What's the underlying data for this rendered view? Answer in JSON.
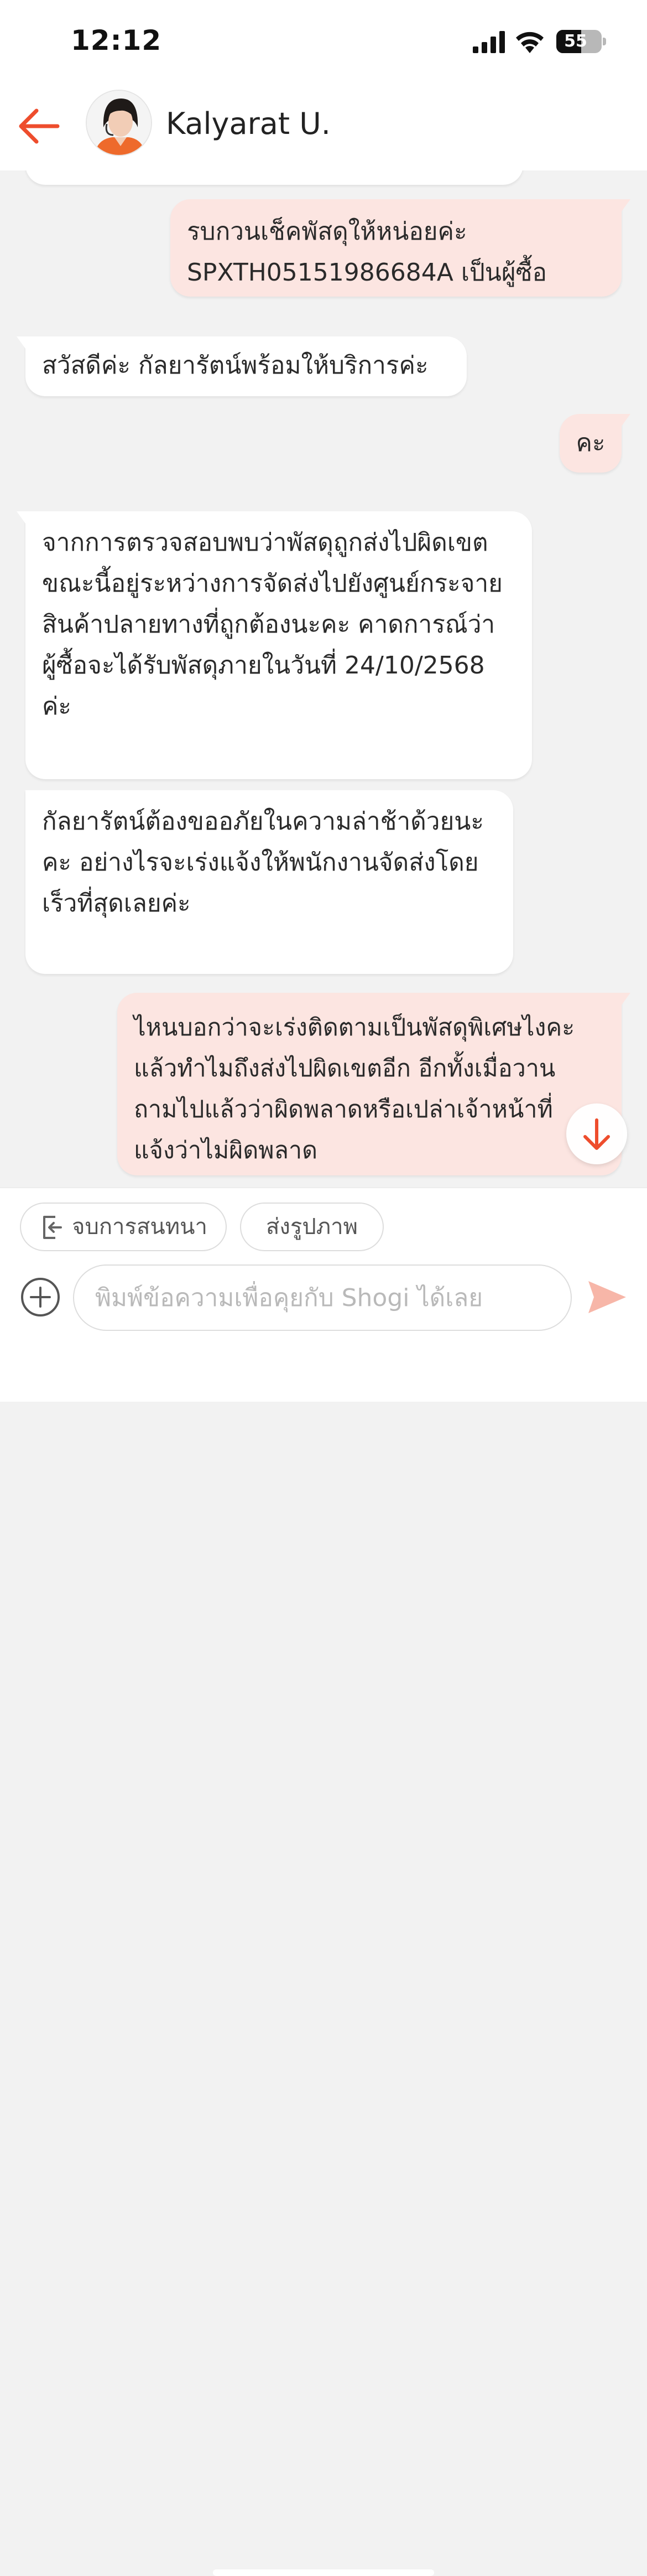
{
  "status_bar": {
    "time": "12:12",
    "battery_label": "55",
    "battery_level_percent": 55
  },
  "header": {
    "contact_name": "Kalyarat U.",
    "back_icon": "arrow-left-icon",
    "accent_color": "#ee4d2d"
  },
  "messages": [
    {
      "direction": "outgoing",
      "text": "รบกวนเช็คพัสดุให้หน่อยค่ะ\nSPXTH05151986684A    เป็นผู้ซื้อ"
    },
    {
      "direction": "incoming",
      "text": "สวัสดีค่ะ กัลยารัตน์พร้อมให้บริการค่ะ"
    },
    {
      "direction": "outgoing",
      "text": "คะ"
    },
    {
      "direction": "incoming",
      "text": "จากการตรวจสอบพบว่าพัสดุถูกส่งไปผิดเขต\nขณะนี้อยู่ระหว่างการจัดส่งไปยังศูนย์กระจาย\nสินค้าปลายทางที่ถูกต้องนะคะ คาดการณ์ว่า\nผู้ซื้อจะได้รับพัสดุภายในวันที่ 24/10/2568\nค่ะ"
    },
    {
      "direction": "incoming",
      "text": "กัลยารัตน์ต้องขออภัยในความล่าช้าด้วยนะ\nคะ อย่างไรจะเร่งแจ้งให้พนักงานจัดส่งโดย\nเร็วที่สุดเลยค่ะ"
    },
    {
      "direction": "outgoing",
      "text": "ไหนบอกว่าจะเร่งติดตามเป็นพัสดุพิเศษไงคะ\nแล้วทำไมถึงส่งไปผิดเขตอีก อีกทั้งเมื่อวาน\nถามไปแล้วว่าผิดพลาดหรือเปล่าเจ้าหน้าที่\nแจ้งว่าไม่ผิดพลาด"
    }
  ],
  "quick_actions": {
    "end_chat_label": "จบการสนทนา",
    "end_chat_icon": "exit-icon",
    "send_photo_label": "ส่งรูปภาพ"
  },
  "composer": {
    "placeholder": "พิมพ์ข้อความเพื่อคุยกับ Shogi ได้เลย",
    "add_icon": "plus-circle-icon",
    "send_icon": "send-icon"
  },
  "scroll_down_icon": "arrow-down-icon",
  "colors": {
    "outgoing_bubble": "#fce5e1",
    "incoming_bubble": "#ffffff",
    "chat_background": "#f2f2f2"
  }
}
